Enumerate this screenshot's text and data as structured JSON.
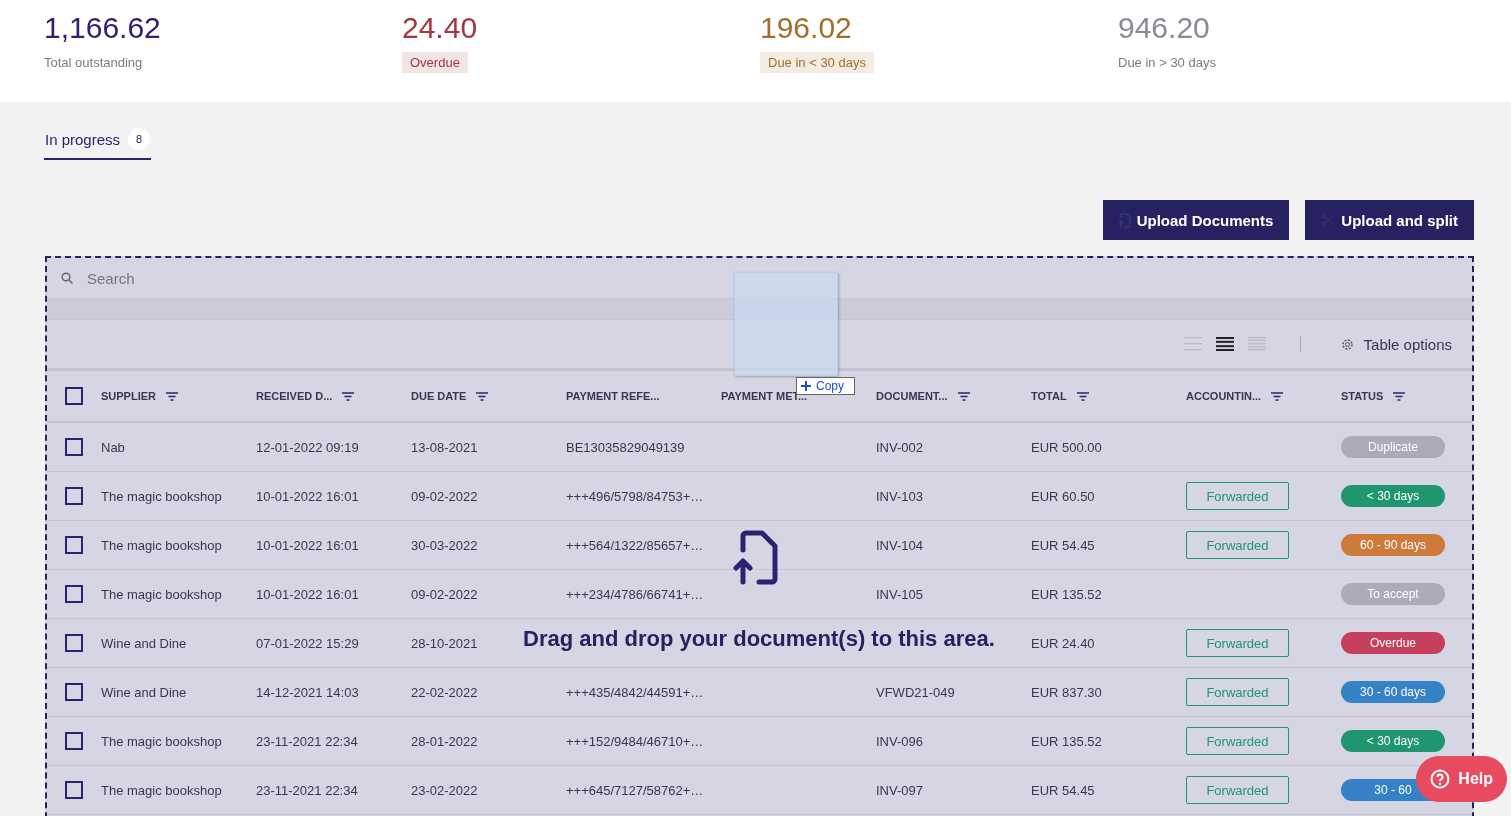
{
  "summary": [
    {
      "value": "1,166.62",
      "label": "Total outstanding",
      "kind": "plain",
      "color": "#2b2370"
    },
    {
      "value": "24.40",
      "label": "Overdue",
      "kind": "tag",
      "color": "#a8343f"
    },
    {
      "value": "196.02",
      "label": "Due in < 30 days",
      "kind": "tag",
      "color": "#a0702a"
    },
    {
      "value": "946.20",
      "label": "Due in > 30 days",
      "kind": "plain",
      "color": "#8a8a95"
    }
  ],
  "tabs": [
    {
      "label": "In progress",
      "count": "8",
      "selected": true
    }
  ],
  "buttons": [
    {
      "label": "Upload Documents",
      "kind": "upload"
    },
    {
      "label": "Upload and split",
      "kind": "split"
    }
  ],
  "search": {
    "placeholder": "Search"
  },
  "density_options": [
    {
      "selected": false
    },
    {
      "selected": true
    },
    {
      "selected": false
    }
  ],
  "table_options": "Table options",
  "table": {
    "select_all": {
      "checked": false
    },
    "columns": [
      {
        "label": "SUPPLIER",
        "filter": true
      },
      {
        "label": "RECEIVED D...",
        "filter": true
      },
      {
        "label": "DUE DATE",
        "filter": true
      },
      {
        "label": "PAYMENT REFE...",
        "filter": false
      },
      {
        "label": "PAYMENT MET...",
        "filter": false
      },
      {
        "label": "DOCUMENT...",
        "filter": true
      },
      {
        "label": "TOTAL",
        "filter": true
      },
      {
        "label": "ACCOUNTIN...",
        "filter": true
      },
      {
        "label": "STATUS",
        "filter": true
      }
    ],
    "rows": [
      {
        "checked": false,
        "supplier": "Nab",
        "received": "12-01-2022 09:19",
        "due": "13-08-2021",
        "payment_reference": "BE13035829049139",
        "document": "INV-002",
        "total": "EUR 500.00",
        "status": "Duplicate",
        "color": "#acabba"
      },
      {
        "checked": false,
        "supplier": "The magic bookshop",
        "received": "10-01-2022 16:01",
        "due": "09-02-2022",
        "payment_reference": "+++496/5798/84753+…",
        "document": "INV-103",
        "total": "EUR 60.50",
        "accounting": "Forwarded",
        "status": "< 30 days",
        "color": "#1f9670"
      },
      {
        "checked": false,
        "supplier": "The magic bookshop",
        "received": "10-01-2022 16:01",
        "due": "30-03-2022",
        "payment_reference": "+++564/1322/85657+…",
        "document": "INV-104",
        "total": "EUR 54.45",
        "accounting": "Forwarded",
        "status": "60 - 90 days",
        "color": "#cd7b3a"
      },
      {
        "checked": false,
        "supplier": "The magic bookshop",
        "received": "10-01-2022 16:01",
        "due": "09-02-2022",
        "payment_reference": "+++234/4786/66741+…",
        "document": "INV-105",
        "total": "EUR 135.52",
        "status": "To accept",
        "color": "#acabba"
      },
      {
        "checked": false,
        "supplier": "Wine and Dine",
        "received": "07-01-2022 15:29",
        "due": "28-10-2021",
        "total": "EUR 24.40",
        "accounting": "Forwarded",
        "status": "Overdue",
        "color": "#c6405e"
      },
      {
        "checked": false,
        "supplier": "Wine and Dine",
        "received": "14-12-2021 14:03",
        "due": "22-02-2022",
        "payment_reference": "+++435/4842/44591+…",
        "document": "VFWD21-049",
        "total": "EUR 837.30",
        "accounting": "Forwarded",
        "status": "30 - 60 days",
        "color": "#3582c6"
      },
      {
        "checked": false,
        "supplier": "The magic bookshop",
        "received": "23-11-2021 22:34",
        "due": "28-01-2022",
        "payment_reference": "+++152/9484/46710+…",
        "document": "INV-096",
        "total": "EUR 135.52",
        "accounting": "Forwarded",
        "status": "< 30 days",
        "color": "#1f9670"
      },
      {
        "checked": false,
        "supplier": "The magic bookshop",
        "received": "23-11-2021 22:34",
        "due": "23-02-2022",
        "payment_reference": "+++645/7127/58762+…",
        "document": "INV-097",
        "total": "EUR 54.45",
        "accounting": "Forwarded",
        "status": "30 - 60",
        "color": "#3582c6"
      }
    ]
  },
  "drop_overlay": {
    "message": "Drag and drop your document(s) to this area.",
    "copy_hint": "Copy"
  },
  "help_button": "Help"
}
